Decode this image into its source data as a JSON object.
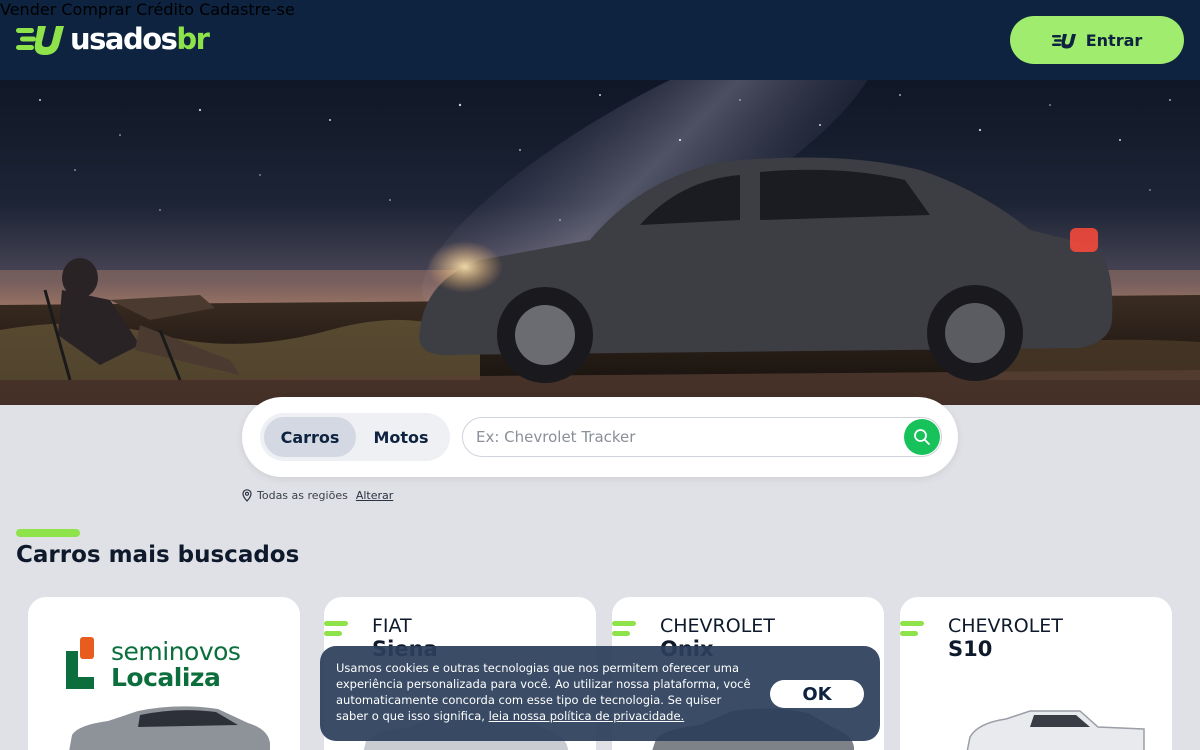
{
  "header": {
    "logo_main": "usados",
    "logo_suffix": "br",
    "nav": [
      "Vender",
      "Comprar",
      "Crédito",
      "Cadastre-se"
    ],
    "login_label": "Entrar"
  },
  "search": {
    "tabs": [
      "Carros",
      "Motos"
    ],
    "active_tab": "Carros",
    "placeholder": "Ex: Chevrolet Tracker",
    "region_label": "Todas as regiões",
    "change_label": "Alterar"
  },
  "section": {
    "title": "Carros mais buscados"
  },
  "cards": [
    {
      "type": "promo",
      "logo_top": "seminovos",
      "logo_bottom": "Localiza"
    },
    {
      "make": "FIAT",
      "model": "Siena"
    },
    {
      "make": "CHEVROLET",
      "model": "Onix"
    },
    {
      "make": "CHEVROLET",
      "model": "S10"
    }
  ],
  "cookie": {
    "text": "Usamos cookies e outras tecnologias que nos permitem oferecer uma experiência personalizada para você. Ao utilizar nossa plataforma, você automaticamente concorda com esse tipo de tecnologia. Se quiser saber o que isso significa,",
    "link": "leia nossa política de privacidade.",
    "ok_label": "OK"
  },
  "colors": {
    "header_bg": "#0e2340",
    "brand_green": "#8ee24a",
    "search_button": "#18c25a"
  }
}
